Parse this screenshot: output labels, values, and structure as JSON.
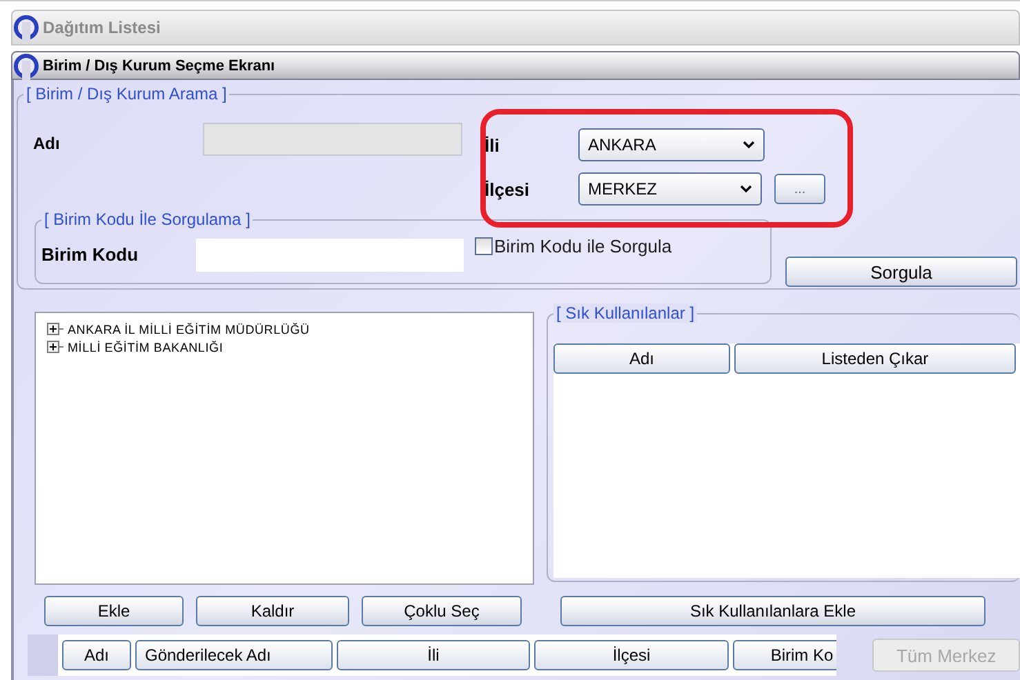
{
  "windows": [
    {
      "title": "Dağıtım Listesi",
      "active": false
    },
    {
      "title": "Birim / Dış Kurum Seçme Ekranı",
      "active": true
    }
  ],
  "search_group": {
    "legend": "[ Birim / Dış Kurum Arama  ]",
    "name_label": "Adı",
    "province_label": "İli",
    "province_value": "ANKARA",
    "district_label": "İlçesi",
    "district_value": "MERKEZ",
    "browse_button": "...",
    "query_button": "Sorgula",
    "code_group": {
      "legend": "[ Birim Kodu İle Sorgulama ]",
      "code_label": "Birim Kodu",
      "checkbox": {
        "label": "Birim Kodu ile Sorgula",
        "checked": false
      }
    }
  },
  "tree": [
    {
      "label": "ANKARA İL MİLLİ EĞİTİM MÜDÜRLÜĞÜ",
      "expanded": false
    },
    {
      "label": "MİLLİ EĞİTİM BAKANLIĞI",
      "expanded": false
    }
  ],
  "favorites": {
    "legend": "[ Sık Kullanılanlar ]",
    "columns": [
      "Adı",
      "Listeden Çıkar"
    ]
  },
  "tree_buttons": [
    "Ekle",
    "Kaldır",
    "Çoklu Seç"
  ],
  "favorites_button": "Sık Kullanılanlara Ekle",
  "table": {
    "columns": [
      "Adı",
      "Gönderilecek Adı",
      "İli",
      "İlçesi",
      "Birim Ko"
    ]
  },
  "all_center_button": {
    "label": "Tüm Merkez",
    "disabled": true
  }
}
